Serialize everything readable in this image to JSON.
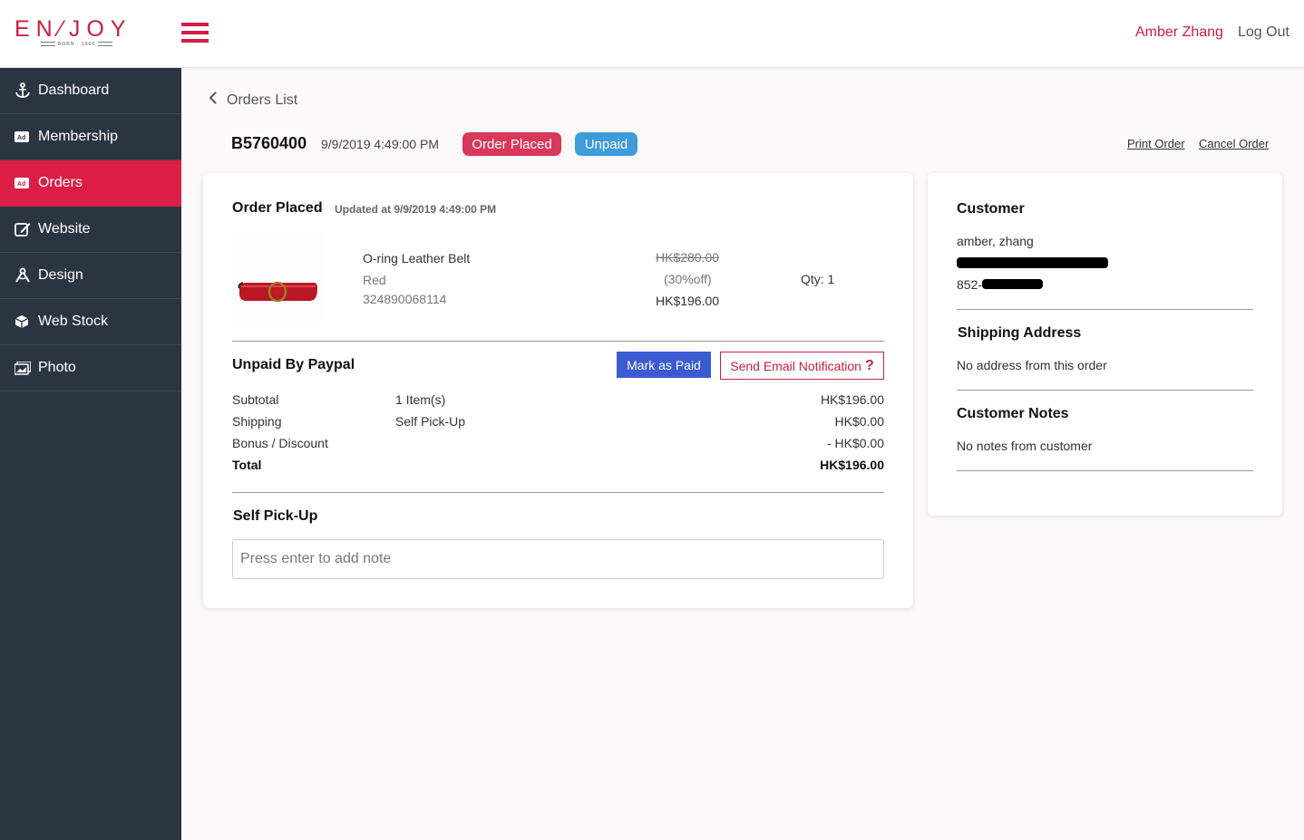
{
  "header": {
    "logo_text": "EN⁄JOY",
    "logo_sub": "BORN · 1966",
    "user_name": "Amber Zhang",
    "logout_label": "Log Out"
  },
  "sidebar": {
    "items": [
      {
        "label": "Dashboard",
        "icon": "anchor-icon"
      },
      {
        "label": "Membership",
        "icon": "ad-icon"
      },
      {
        "label": "Orders",
        "icon": "ad-icon",
        "active": true
      },
      {
        "label": "Website",
        "icon": "edit-icon"
      },
      {
        "label": "Design",
        "icon": "design-icon"
      },
      {
        "label": "Web Stock",
        "icon": "cube-icon"
      },
      {
        "label": "Photo",
        "icon": "image-icon"
      }
    ]
  },
  "breadcrumb": {
    "back_label": "Orders List"
  },
  "order": {
    "id": "B5760400",
    "date": "9/9/2019 4:49:00 PM",
    "status_badge": "Order Placed",
    "payment_badge": "Unpaid",
    "print_label": "Print Order",
    "cancel_label": "Cancel Order"
  },
  "status_section": {
    "title": "Order Placed",
    "updated": "Updated at 9/9/2019 4:49:00 PM"
  },
  "product": {
    "name": "O-ring Leather Belt",
    "color": "Red",
    "sku": "324890068114",
    "original_price": "HK$280.00",
    "discount": "(30%off)",
    "price": "HK$196.00",
    "qty": "Qty: 1"
  },
  "payment": {
    "title": "Unpaid By Paypal",
    "mark_paid_label": "Mark as Paid",
    "email_label": "Send Email Notification",
    "rows": [
      {
        "label": "Subtotal",
        "detail": "1 Item(s)",
        "amount": "HK$196.00"
      },
      {
        "label": "Shipping",
        "detail": "Self Pick-Up",
        "amount": "HK$0.00"
      },
      {
        "label": "Bonus / Discount",
        "detail": "",
        "amount": "- HK$0.00"
      },
      {
        "label": "Total",
        "detail": "",
        "amount": "HK$196.00"
      }
    ]
  },
  "pickup": {
    "title": "Self Pick-Up",
    "note_placeholder": "Press enter to add note"
  },
  "customer": {
    "title": "Customer",
    "name": "amber, zhang",
    "phone_prefix": "852-",
    "shipping_title": "Shipping Address",
    "shipping_text": "No address from this order",
    "notes_title": "Customer Notes",
    "notes_text": "No notes from customer"
  },
  "colors": {
    "brand": "#c8203c",
    "sidebar_bg": "#2b3542",
    "active_item": "#dc1e46",
    "badge_placed": "#d8385a",
    "badge_unpaid": "#3f9bd9",
    "mark_paid": "#3a5bd1"
  }
}
